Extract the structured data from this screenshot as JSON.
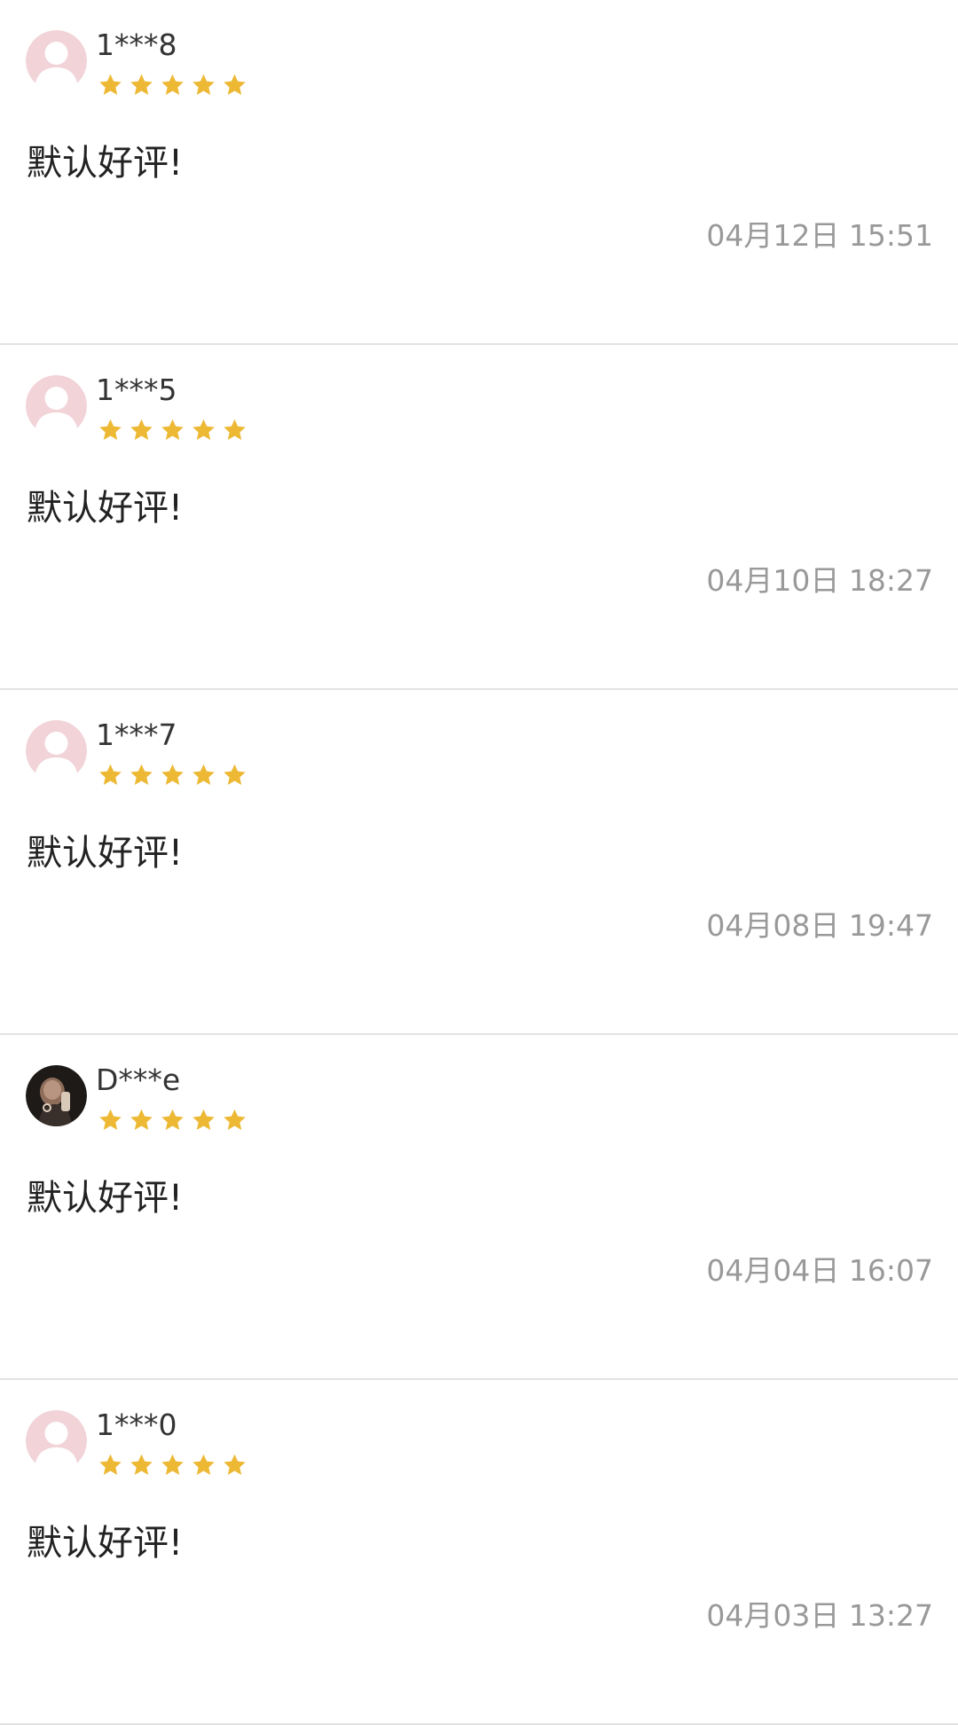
{
  "colors": {
    "star": "#EDB935",
    "avatar_placeholder": "#F1D3D8",
    "divider": "#E3E3E3",
    "text_primary": "#222222",
    "text_secondary": "#999999"
  },
  "reviews": [
    {
      "username": "1***8",
      "rating": 5,
      "content": "默认好评!",
      "timestamp": "04月12日 15:51",
      "avatar": "default-avatar"
    },
    {
      "username": "1***5",
      "rating": 5,
      "content": "默认好评!",
      "timestamp": "04月10日 18:27",
      "avatar": "default-avatar"
    },
    {
      "username": "1***7",
      "rating": 5,
      "content": "默认好评!",
      "timestamp": "04月08日 19:47",
      "avatar": "default-avatar"
    },
    {
      "username": "D***e",
      "rating": 5,
      "content": "默认好评!",
      "timestamp": "04月04日 16:07",
      "avatar": "photo-avatar"
    },
    {
      "username": "1***0",
      "rating": 5,
      "content": "默认好评!",
      "timestamp": "04月03日 13:27",
      "avatar": "default-avatar"
    }
  ]
}
